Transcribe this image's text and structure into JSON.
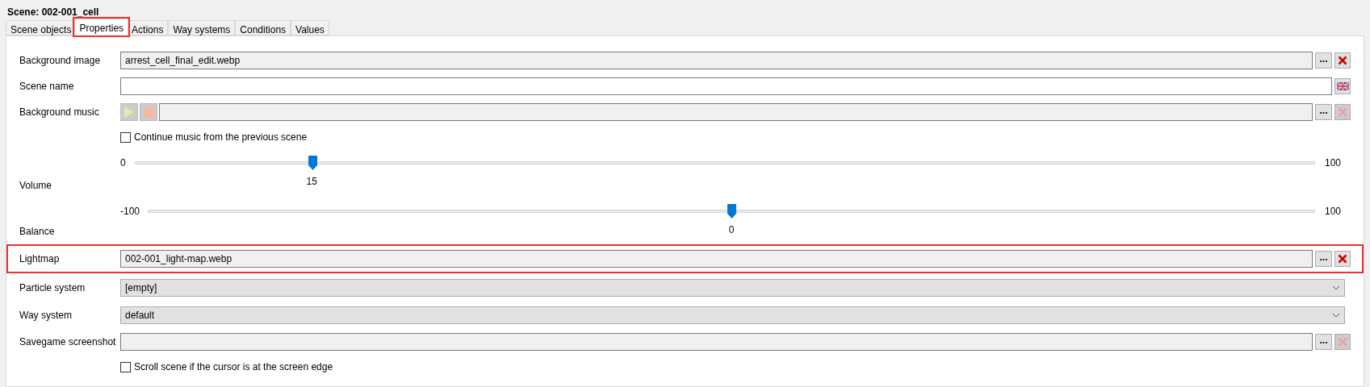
{
  "title": "Scene: 002-001_cell",
  "tabs": [
    {
      "label": "Scene objects",
      "selected": false,
      "highlighted": false
    },
    {
      "label": "Properties",
      "selected": true,
      "highlighted": true
    },
    {
      "label": "Actions",
      "selected": false,
      "highlighted": false
    },
    {
      "label": "Way systems",
      "selected": false,
      "highlighted": false
    },
    {
      "label": "Conditions",
      "selected": false,
      "highlighted": false
    },
    {
      "label": "Values",
      "selected": false,
      "highlighted": false
    }
  ],
  "rows": [
    {
      "kind": "file",
      "label": "Background image",
      "value": "arrest_cell_final_edit.webp",
      "browse": "...",
      "clear_disabled": false,
      "highlighted": false
    },
    {
      "kind": "text",
      "label": "Scene name"
    },
    {
      "kind": "music",
      "label": "Background music",
      "browse": "...",
      "clear_disabled": true,
      "play_disabled": true
    },
    {
      "kind": "checkbox",
      "label": "Continue music from the previous scene",
      "checked": false
    },
    {
      "kind": "slider",
      "label": "Volume",
      "min": "0",
      "max": "100",
      "value": "15",
      "level": 0.15
    },
    {
      "kind": "slider",
      "label": "Balance",
      "min": "-100",
      "max": "100",
      "value": "0",
      "level": 0.5
    },
    {
      "kind": "file",
      "label": "Lightmap",
      "value": "002-001_light-map.webp",
      "browse": "...",
      "clear_disabled": false,
      "highlighted": true
    },
    {
      "kind": "select",
      "label": "Particle system",
      "value": "[empty]"
    },
    {
      "kind": "select",
      "label": "Way system",
      "value": "default"
    },
    {
      "kind": "file",
      "label": "Savegame screenshot",
      "browse": "...",
      "clear_disabled": true,
      "highlighted": false
    },
    {
      "kind": "checkbox",
      "label": "Scroll scene if the cursor is at the screen edge",
      "checked": false
    }
  ]
}
